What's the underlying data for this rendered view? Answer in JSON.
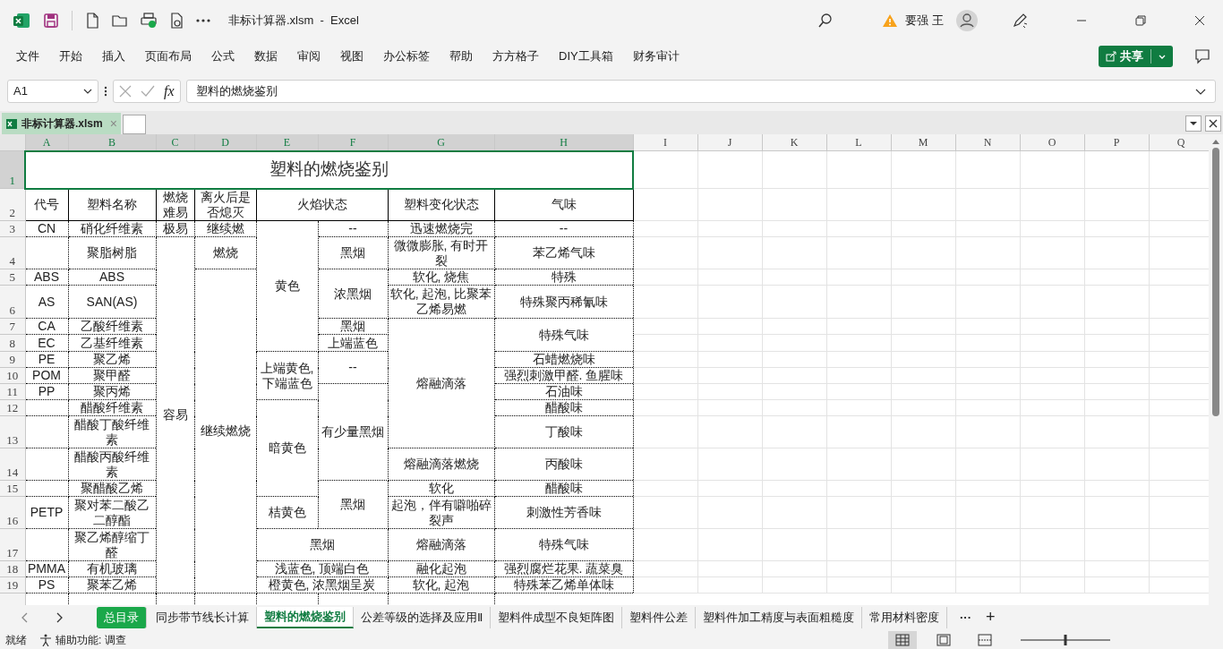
{
  "window": {
    "title": "非标计算器.xlsm  -  Excel",
    "user": "要强 王"
  },
  "menu": [
    {
      "label": "文件"
    },
    {
      "label": "开始"
    },
    {
      "label": "插入"
    },
    {
      "label": "页面布局"
    },
    {
      "label": "公式"
    },
    {
      "label": "数据"
    },
    {
      "label": "审阅"
    },
    {
      "label": "视图"
    },
    {
      "label": "办公标签"
    },
    {
      "label": "帮助"
    },
    {
      "label": "方方格子"
    },
    {
      "label": "DIY工具箱"
    },
    {
      "label": "财务审计"
    }
  ],
  "share_button": "共享",
  "formula_bar": {
    "name_box": "A1",
    "fx": "fx",
    "value": "塑料的燃烧鉴别"
  },
  "workbook_tabs": [
    {
      "label": "非标计算器.xlsm",
      "close": "×"
    }
  ],
  "columns": [
    {
      "label": "A",
      "selected": true
    },
    {
      "label": "B",
      "selected": true
    },
    {
      "label": "C",
      "selected": true
    },
    {
      "label": "D",
      "selected": true
    },
    {
      "label": "E",
      "selected": true
    },
    {
      "label": "F",
      "selected": true
    },
    {
      "label": "G",
      "selected": true
    },
    {
      "label": "H",
      "selected": true
    },
    {
      "label": "I",
      "selected": false
    },
    {
      "label": "J",
      "selected": false
    },
    {
      "label": "K",
      "selected": false
    },
    {
      "label": "L",
      "selected": false
    },
    {
      "label": "M",
      "selected": false
    },
    {
      "label": "N",
      "selected": false
    },
    {
      "label": "O",
      "selected": false
    },
    {
      "label": "P",
      "selected": false
    },
    {
      "label": "Q",
      "selected": false
    }
  ],
  "row_headers": [
    {
      "label": "1",
      "selected": true
    },
    {
      "label": "2",
      "selected": false
    },
    {
      "label": "3",
      "selected": false
    },
    {
      "label": "4",
      "selected": false
    },
    {
      "label": "5",
      "selected": false
    },
    {
      "label": "6",
      "selected": false
    },
    {
      "label": "7",
      "selected": false
    },
    {
      "label": "8",
      "selected": false
    },
    {
      "label": "9",
      "selected": false
    },
    {
      "label": "10",
      "selected": false
    },
    {
      "label": "11",
      "selected": false
    },
    {
      "label": "12",
      "selected": false
    },
    {
      "label": "13",
      "selected": false
    },
    {
      "label": "14",
      "selected": false
    },
    {
      "label": "15",
      "selected": false
    },
    {
      "label": "16",
      "selected": false
    },
    {
      "label": "17",
      "selected": false
    },
    {
      "label": "18",
      "selected": false
    },
    {
      "label": "19",
      "selected": false
    }
  ],
  "sheet": {
    "title": {
      "text": "塑料的燃烧鉴别",
      "selected": true
    },
    "rows": [
      [
        {
          "text": "代号"
        },
        {
          "text": "塑料名称"
        },
        {
          "text": "燃烧难易"
        },
        {
          "text": "离火后是否熄灭"
        },
        {
          "text": "火焰状态",
          "colspan": 2
        },
        {
          "text": "塑料变化状态"
        },
        {
          "text": "气味"
        }
      ],
      [
        {
          "text": "CN"
        },
        {
          "text": "硝化纤维素"
        },
        {
          "text": "极易"
        },
        {
          "text": "继续燃"
        },
        {
          "text": "黄色",
          "rowspan": 6
        },
        {
          "text": "--"
        },
        {
          "text": "迅速燃烧完"
        },
        {
          "text": "--"
        }
      ],
      [
        {},
        {
          "text": "聚脂树脂"
        },
        {
          "text": "容易",
          "rowspan": 16
        },
        {
          "text": "燃烧"
        },
        {
          "text": "黑烟"
        },
        {
          "text": "微微膨胀, 有时开裂"
        },
        {
          "text": "苯乙烯气味"
        }
      ],
      [
        {
          "text": "ABS"
        },
        {
          "text": "ABS"
        },
        {
          "text": "继续燃烧",
          "rowspan": 15
        },
        {
          "text": "浓黑烟",
          "rowspan": 2
        },
        {
          "text": "软化, 烧焦"
        },
        {
          "text": "特殊"
        }
      ],
      [
        {
          "text": "AS"
        },
        {
          "text": "SAN(AS)"
        },
        {
          "text": "软化, 起泡, 比聚苯乙烯易燃"
        },
        {
          "text": "特殊聚丙稀氰味"
        }
      ],
      [
        {
          "text": "CA"
        },
        {
          "text": "乙酸纤维素"
        },
        {
          "text": "黑烟"
        },
        {
          "text": "熔融滴落",
          "rowspan": 7
        },
        {
          "text": "特殊气味",
          "rowspan": 2
        }
      ],
      [
        {
          "text": "EC"
        },
        {
          "text": "乙基纤维素"
        },
        {
          "text": "上端蓝色"
        }
      ],
      [
        {
          "text": "PE"
        },
        {
          "text": "聚乙烯"
        },
        {
          "text": "上端黄色, 下端蓝色",
          "rowspan": 3
        },
        {
          "text": "--",
          "rowspan": 2
        },
        {
          "text": "石蜡燃烧味"
        }
      ],
      [
        {
          "text": "POM"
        },
        {
          "text": "聚甲醛"
        },
        {
          "text": "强烈刺激甲醛. 鱼腥味"
        }
      ],
      [
        {
          "text": "PP"
        },
        {
          "text": "聚丙烯"
        },
        {
          "text": "有少量黑烟",
          "rowspan": 4
        },
        {
          "text": "石油味"
        }
      ],
      [
        {},
        {
          "text": "醋酸纤维素"
        },
        {
          "text": "暗黄色",
          "rowspan": 4
        },
        {
          "text": "醋酸味"
        }
      ],
      [
        {},
        {
          "text": "醋酸丁酸纤维素"
        },
        {
          "text": "丁酸味"
        }
      ],
      [
        {},
        {
          "text": "醋酸丙酸纤维素"
        },
        {
          "text": "熔融滴落燃烧"
        },
        {
          "text": "丙酸味"
        }
      ],
      [
        {},
        {
          "text": "聚醋酸乙烯"
        },
        {
          "text": "黑烟",
          "rowspan": 2
        },
        {
          "text": "软化"
        },
        {
          "text": "醋酸味"
        }
      ],
      [
        {
          "text": "PETP"
        },
        {
          "text": "聚对苯二酸乙二醇酯"
        },
        {
          "text": "桔黄色"
        },
        {
          "text": "起泡，伴有噼啪碎裂声"
        },
        {
          "text": "刺激性芳香味"
        }
      ],
      [
        {},
        {
          "text": "聚乙烯醇缩丁醛"
        },
        {
          "text": "黑烟",
          "colspan": 2
        },
        {
          "text": "熔融滴落"
        },
        {
          "text": "特殊气味"
        }
      ],
      [
        {
          "text": "PMMA"
        },
        {
          "text": "有机玻璃"
        },
        {
          "text": "浅蓝色, 顶端白色",
          "colspan": 2
        },
        {
          "text": "融化起泡"
        },
        {
          "text": "强烈腐烂花果. 蔬菜臭"
        }
      ],
      [
        {
          "text": "PS"
        },
        {
          "text": "聚苯乙烯"
        },
        {
          "text": "橙黄色, 浓黑烟呈炭",
          "colspan": 2
        },
        {
          "text": "软化, 起泡"
        },
        {
          "text": "特殊苯乙烯单体味"
        }
      ]
    ]
  },
  "sheet_tabs": [
    {
      "label": "总目录",
      "selected": false,
      "color": "#1aa84a"
    },
    {
      "label": "同步带节线长计算",
      "selected": false
    },
    {
      "label": "塑料的燃烧鉴别",
      "selected": true
    },
    {
      "label": "公差等级的选择及应用Ⅱ",
      "selected": false
    },
    {
      "label": "塑料件成型不良矩阵图",
      "selected": false
    },
    {
      "label": "塑料件公差",
      "selected": false
    },
    {
      "label": "塑料件加工精度与表面粗糙度",
      "selected": false
    },
    {
      "label": "常用材料密度",
      "selected": false
    }
  ],
  "sheet_tabs_more": "···",
  "sheet_tabs_add": "+",
  "status_bar": {
    "ready": "就绪",
    "accessibility": "辅助功能: 调查",
    "views": [
      {
        "kind": "normal",
        "selected": true
      },
      {
        "kind": "page-layout",
        "selected": false
      },
      {
        "kind": "page-break",
        "selected": false
      }
    ],
    "zoom": {
      "level": 0.5
    }
  }
}
